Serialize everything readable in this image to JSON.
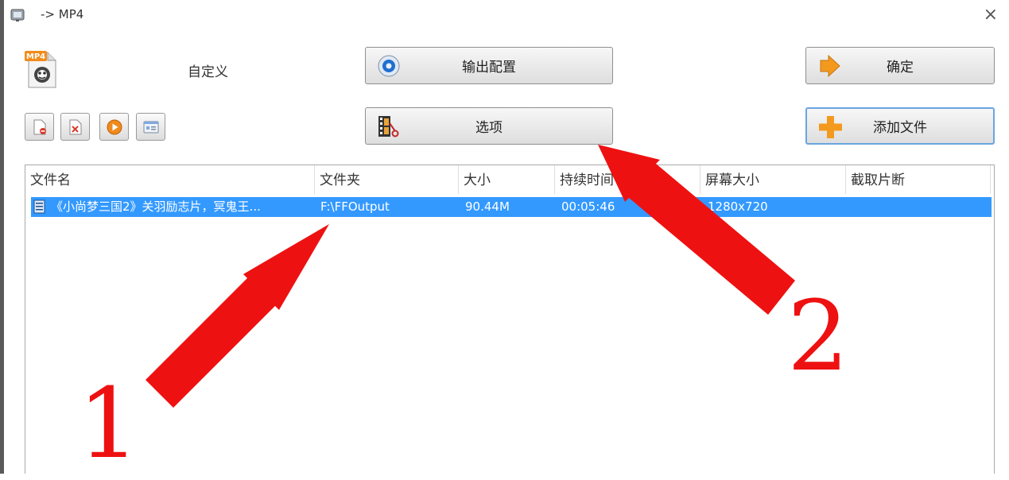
{
  "window": {
    "title": "-> MP4",
    "close_glyph": "×"
  },
  "profile": {
    "label": "自定义",
    "badge": "MP4",
    "icon": "mp4-file-icon"
  },
  "buttons": {
    "output_config": "输出配置",
    "options": "选项",
    "ok": "确定",
    "add_file": "添加文件"
  },
  "toolbar": {
    "icons": [
      "remove-file-icon",
      "clear-list-icon",
      "play-icon",
      "media-info-icon"
    ]
  },
  "file_list": {
    "columns": [
      "文件名",
      "文件夹",
      "大小",
      "持续时间",
      "屏幕大小",
      "截取片断"
    ],
    "rows": [
      {
        "name": "《小尚梦三国2》关羽励志片，冥鬼王...",
        "folder": "F:\\FFOutput",
        "size": "90.44M",
        "duration": "00:05:46",
        "screen": "1280x720",
        "clip": ""
      }
    ]
  },
  "annotations": {
    "arrow1_label": "1",
    "arrow2_label": "2",
    "color": "#ee1111"
  },
  "colors": {
    "selection": "#3399ff",
    "add_button_border": "#6aa5e0",
    "annotation": "#ee1111"
  }
}
